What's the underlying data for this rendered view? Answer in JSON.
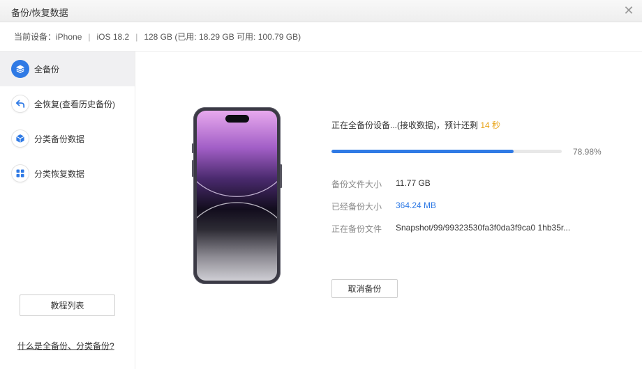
{
  "window": {
    "title": "备份/恢复数据",
    "close_glyph": "✕"
  },
  "device_info": {
    "device": "当前设备：iPhone",
    "ios": "iOS 18.2",
    "storage": "128 GB (已用: 18.29 GB 可用: 100.79 GB)",
    "separator": "|"
  },
  "sidebar": {
    "items": [
      {
        "label": "全备份",
        "icon": "layers-icon",
        "active": true
      },
      {
        "label": "全恢复(查看历史备份)",
        "icon": "restore-arrow-icon",
        "active": false
      },
      {
        "label": "分类备份数据",
        "icon": "cube-icon",
        "active": false
      },
      {
        "label": "分类恢复数据",
        "icon": "grid-icon",
        "active": false
      }
    ],
    "tutorial_button": "教程列表",
    "help_link": "什么是全备份、分类备份?"
  },
  "backup": {
    "status_prefix": "正在全备份设备...(接收数据)，预计还剩",
    "remaining_time": "14 秒",
    "progress_fraction": 0.7898,
    "progress_text": "78.98%",
    "rows": [
      {
        "label": "备份文件大小",
        "value": "11.77 GB"
      },
      {
        "label": "已经备份大小",
        "value": "364.24 MB"
      },
      {
        "label": "正在备份文件",
        "value": "Snapshot/99/99323530fa3f0da3f9ca0 1hb35r..."
      }
    ],
    "cancel_button": "取消备份"
  },
  "colors": {
    "accent": "#2f7ae5",
    "time_highlight": "#e8a317"
  }
}
